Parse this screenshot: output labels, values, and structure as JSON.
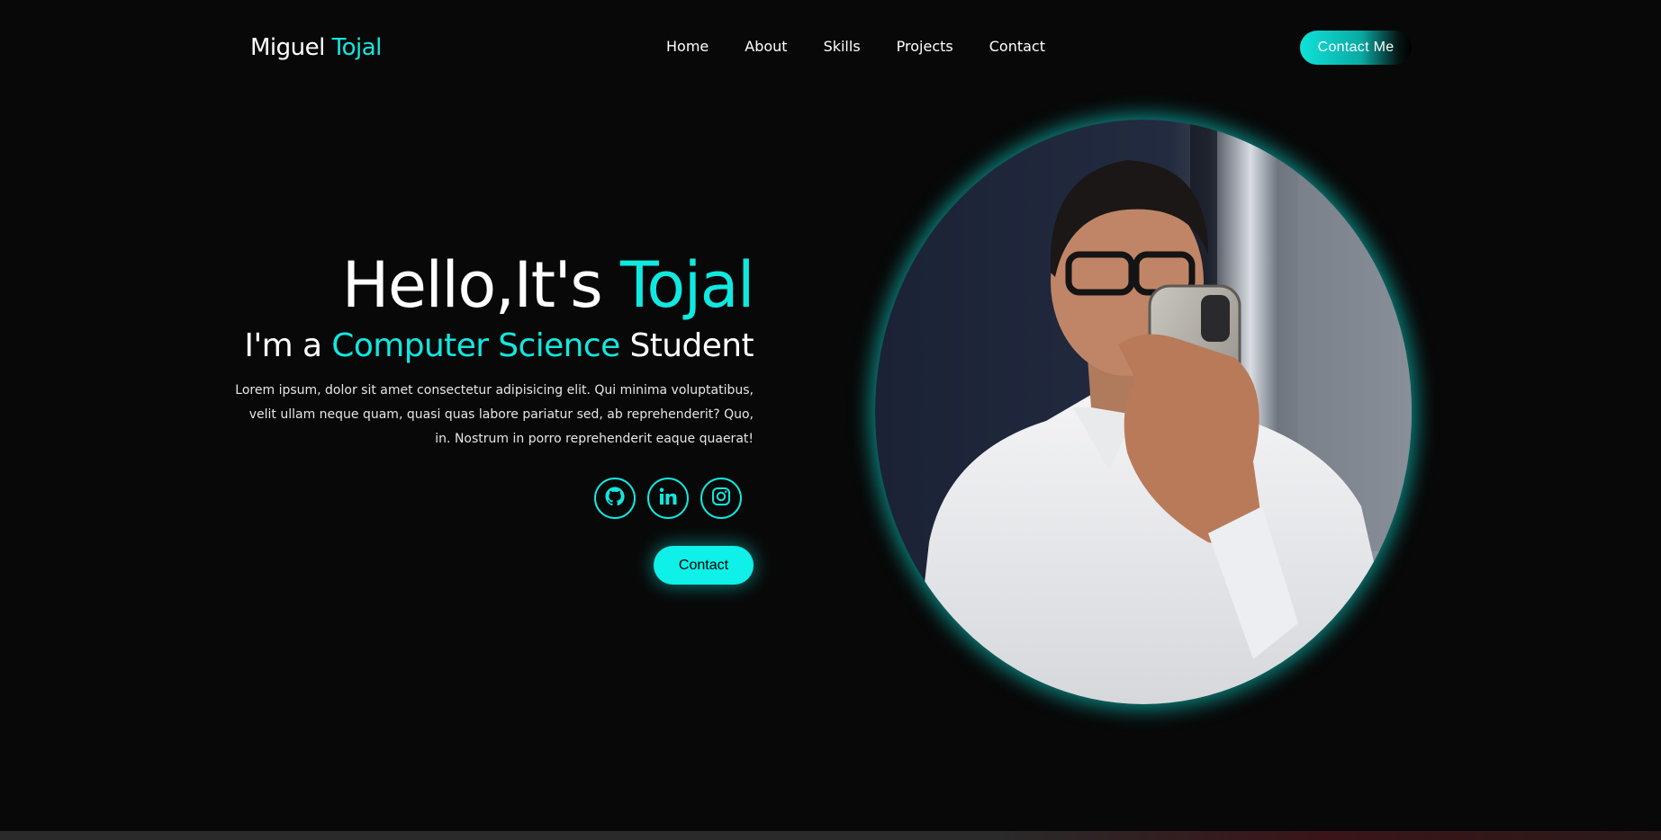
{
  "header": {
    "logo_first": "Miguel",
    "logo_last": "Tojal",
    "nav": [
      {
        "label": "Home"
      },
      {
        "label": "About"
      },
      {
        "label": "Skills"
      },
      {
        "label": "Projects"
      },
      {
        "label": "Contact"
      }
    ],
    "cta_label": "Contact Me"
  },
  "hero": {
    "greeting": "Hello,It's",
    "name": "Tojal",
    "sub_prefix": "I'm a",
    "sub_role": "Computer Science",
    "sub_suffix": "Student",
    "description": "Lorem ipsum, dolor sit amet consectetur adipisicing elit. Qui minima voluptatibus, velit ullam neque quam, quasi quas labore pariatur sed, ab reprehenderit? Quo, in. Nostrum in porro reprehenderit eaque quaerat!",
    "socials": [
      {
        "icon": "github-icon"
      },
      {
        "icon": "linkedin-icon"
      },
      {
        "icon": "instagram-icon"
      }
    ],
    "contact_label": "Contact"
  },
  "colors": {
    "accent": "#11e8e0",
    "background": "#080808",
    "text": "#ffffff"
  }
}
